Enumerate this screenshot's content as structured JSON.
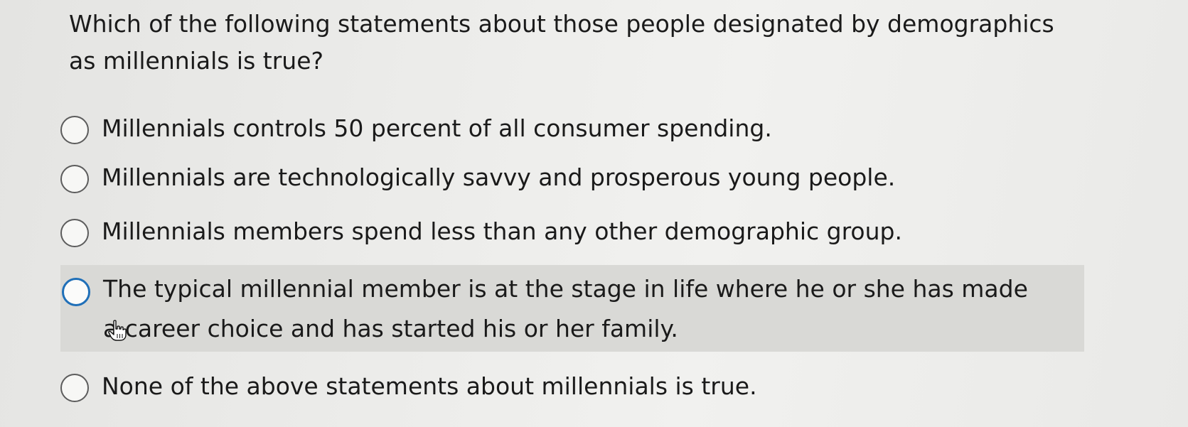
{
  "question": {
    "text": "Which of the following statements about those people designated by demographics as millennials is true?"
  },
  "options": [
    {
      "label": "Millennials controls 50 percent of all consumer spending.",
      "selected": false,
      "hovered": false
    },
    {
      "label": "Millennials are technologically savvy and prosperous young people.",
      "selected": false,
      "hovered": false
    },
    {
      "label": "Millennials members spend less than any other demographic group.",
      "selected": false,
      "hovered": false
    },
    {
      "label": "The typical millennial member is at the stage in life where he or she has made a career choice and has started his or her family.",
      "selected": false,
      "hovered": true
    },
    {
      "label": "None of the above statements about millennials is true.",
      "selected": false,
      "hovered": false
    }
  ],
  "colors": {
    "hover_background": "#d9d9d6",
    "focus_ring": "#1f6fb8"
  },
  "cursor": "hand-pointer-icon"
}
